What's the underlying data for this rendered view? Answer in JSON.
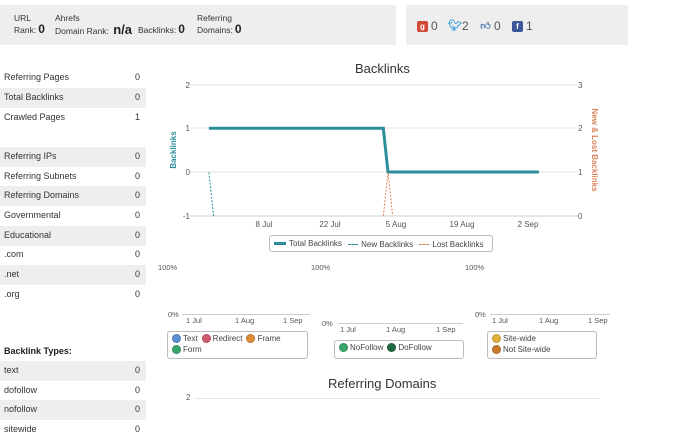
{
  "stats": {
    "url_rank_label_1": "URL",
    "url_rank_label_2": "Rank:",
    "url_rank_value": "0",
    "ahrefs_label_1": "Ahrefs",
    "ahrefs_label_2": "Domain Rank:",
    "ahrefs_value": "n/a",
    "backlinks_label": "Backlinks:",
    "backlinks_value": "0",
    "referring_label_1": "Referring",
    "referring_label_2": "Domains:",
    "referring_value": "0"
  },
  "social": {
    "gplus_value": "0",
    "twitter_value": "2",
    "like_value": "0",
    "facebook_value": "1",
    "gplus_color": "#d34836",
    "twitter_color": "#3a9bd9",
    "like_color": "#5a7fb0",
    "facebook_color": "#3b5998"
  },
  "sidebar": {
    "group1": [
      {
        "label": "Referring Pages",
        "value": "0"
      },
      {
        "label": "Total Backlinks",
        "value": "0"
      },
      {
        "label": "Crawled Pages",
        "value": "1"
      }
    ],
    "group2": [
      {
        "label": "Referring IPs",
        "value": "0"
      },
      {
        "label": "Referring Subnets",
        "value": "0"
      },
      {
        "label": "Referring Domains",
        "value": "0"
      },
      {
        "label": "Governmental",
        "value": "0"
      },
      {
        "label": "Educational",
        "value": "0"
      },
      {
        "label": ".com",
        "value": "0"
      },
      {
        "label": ".net",
        "value": "0"
      },
      {
        "label": ".org",
        "value": "0"
      }
    ],
    "types_heading": "Backlink Types:",
    "group3": [
      {
        "label": "text",
        "value": "0"
      },
      {
        "label": "dofollow",
        "value": "0"
      },
      {
        "label": "nofollow",
        "value": "0"
      },
      {
        "label": "sitewide",
        "value": "0"
      }
    ]
  },
  "chart_data": [
    {
      "type": "line",
      "title": "Backlinks",
      "ylabel_left": "Backlinks",
      "ylabel_right": "New & Lost Backlinks",
      "x_ticks": [
        "8 Jul",
        "22 Jul",
        "5 Aug",
        "19 Aug",
        "2 Sep"
      ],
      "y_left_ticks": [
        "2",
        "1",
        "0",
        "-1"
      ],
      "y_right_ticks": [
        "3",
        "2",
        "1",
        "0"
      ],
      "ylim_left": [
        -1,
        2
      ],
      "ylim_right": [
        0,
        3
      ],
      "series": [
        {
          "name": "Total Backlinks",
          "color": "#2b8f9b",
          "points": [
            [
              "2013-06-28",
              1
            ],
            [
              "2013-08-04",
              1
            ],
            [
              "2013-08-05",
              0
            ],
            [
              "2013-09-06",
              0
            ]
          ]
        },
        {
          "name": "New Backlinks",
          "color": "#2b8f9b",
          "points": [
            [
              "2013-06-28",
              1
            ],
            [
              "2013-06-29",
              0
            ]
          ]
        },
        {
          "name": "Lost Backlinks",
          "color": "#d9835c",
          "points": [
            [
              "2013-08-04",
              0
            ],
            [
              "2013-08-05",
              1
            ],
            [
              "2013-08-06",
              0
            ]
          ]
        }
      ]
    },
    {
      "type": "area",
      "y_top": "100%",
      "y_bottom": "0%",
      "x_ticks": [
        "1 Jul",
        "1 Aug",
        "1 Sep"
      ],
      "series": [
        {
          "name": "Text",
          "color": "#5b8fd3"
        },
        {
          "name": "Redirect",
          "color": "#d35b6e"
        },
        {
          "name": "Frame",
          "color": "#e08a3c"
        },
        {
          "name": "Form",
          "color": "#3aa66b"
        }
      ]
    },
    {
      "type": "area",
      "y_top": "100%",
      "y_bottom": "0%",
      "x_ticks": [
        "1 Jul",
        "1 Aug",
        "1 Sep"
      ],
      "series": [
        {
          "name": "NoFollow",
          "color": "#3aa66b"
        },
        {
          "name": "DoFollow",
          "color": "#1f6b3f"
        }
      ]
    },
    {
      "type": "area",
      "y_top": "100%",
      "y_bottom": "0%",
      "x_ticks": [
        "1 Jul",
        "1 Aug",
        "1 Sep"
      ],
      "series": [
        {
          "name": "Site-wide",
          "color": "#e0b23c"
        },
        {
          "name": "Not Site-wide",
          "color": "#c97a2b"
        }
      ]
    },
    {
      "type": "line",
      "title": "Referring Domains",
      "y_ticks": [
        "2"
      ]
    }
  ]
}
